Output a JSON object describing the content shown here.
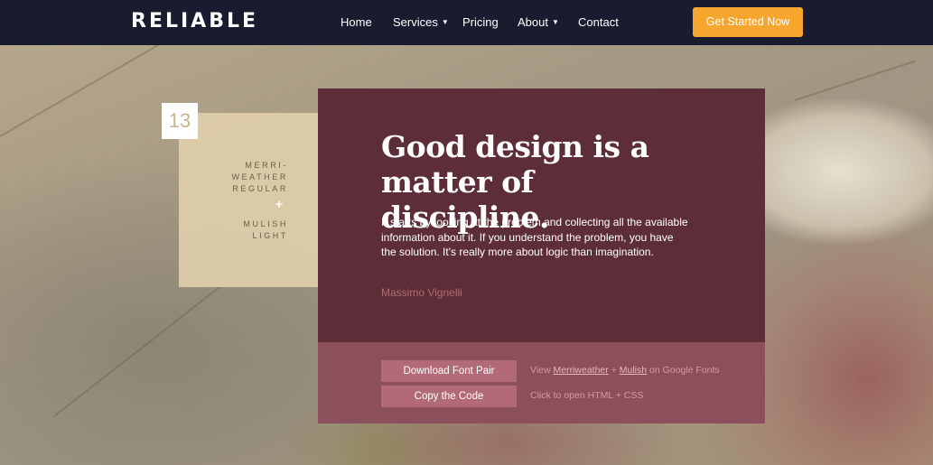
{
  "nav": {
    "logo": "RELIABLE",
    "links": [
      {
        "label": "Home"
      },
      {
        "label": "Services",
        "dropdown": true
      },
      {
        "label": "Pricing"
      },
      {
        "label": "About",
        "dropdown": true
      },
      {
        "label": "Contact"
      }
    ],
    "cta_label": "Get Started Now",
    "caret_icon": "chevron-down-icon"
  },
  "pair": {
    "number": "13",
    "heading_font_lines": [
      "MERRI-",
      "WEATHER",
      "REGULAR"
    ],
    "plus": "+",
    "body_font_lines": [
      "MULISH",
      "LIGHT"
    ]
  },
  "card": {
    "headline": "Good design is a matter of discipline.",
    "quote": "It starts by looking at the problem and collecting all the available information about it. If you understand the problem, you have the solution. It's really more about logic than imagination.",
    "author": "Massimo Vignelli"
  },
  "actions": {
    "download_label": "Download Font Pair",
    "copy_label": "Copy the Code",
    "view_prefix": "View",
    "font_link_1": "Merriweather",
    "plus_sep": "+",
    "font_link_2": "Mulish",
    "view_suffix": "on Google Fonts",
    "copy_note": "Click to open HTML + CSS"
  },
  "colors": {
    "navbar": "#191b2e",
    "cta": "#f6a52f",
    "card": "#5d2e37",
    "actions": "#8b505b",
    "button": "#b26b76",
    "font_panel": "#e0ceab"
  }
}
